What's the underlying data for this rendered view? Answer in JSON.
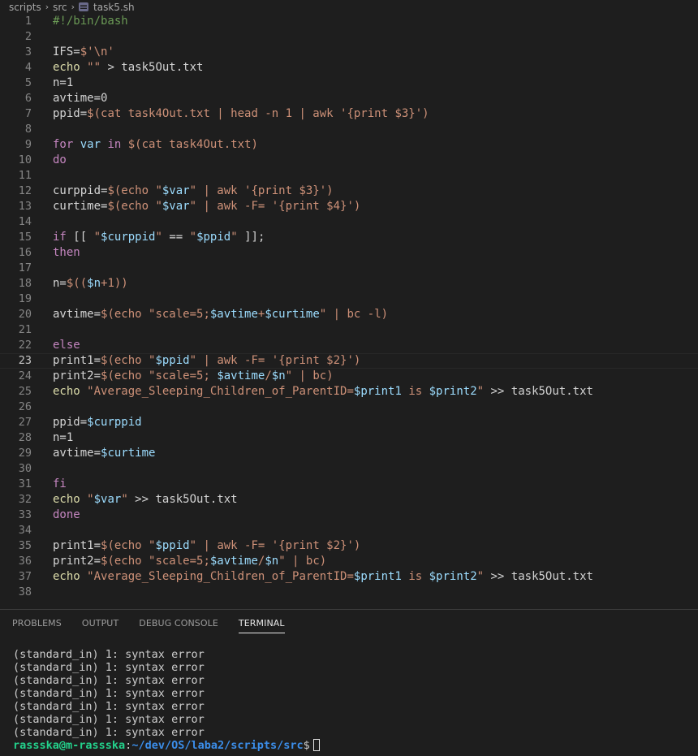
{
  "breadcrumb": {
    "items": [
      "scripts",
      "src"
    ],
    "file": "task5.sh"
  },
  "editor": {
    "current_line": 23,
    "lines": [
      [
        {
          "t": "#!/bin/bash",
          "c": "#6a9955"
        }
      ],
      [],
      [
        {
          "t": "IFS=",
          "c": "#d4d4d4"
        },
        {
          "t": "$'\\n'",
          "c": "#ce9178"
        }
      ],
      [
        {
          "t": "echo ",
          "c": "#dcdcaa"
        },
        {
          "t": "\"\"",
          "c": "#ce9178"
        },
        {
          "t": " > task5Out.txt",
          "c": "#d4d4d4"
        }
      ],
      [
        {
          "t": "n=1",
          "c": "#d4d4d4"
        }
      ],
      [
        {
          "t": "avtime=0",
          "c": "#d4d4d4"
        }
      ],
      [
        {
          "t": "ppid=",
          "c": "#d4d4d4"
        },
        {
          "t": "$(cat task4Out.txt | head -n 1 | awk '{print $3}')",
          "c": "#ce9178"
        }
      ],
      [],
      [
        {
          "t": "for ",
          "c": "#c586c0"
        },
        {
          "t": "var ",
          "c": "#9cdcfe"
        },
        {
          "t": "in ",
          "c": "#c586c0"
        },
        {
          "t": "$(cat task4Out.txt)",
          "c": "#ce9178"
        }
      ],
      [
        {
          "t": "do",
          "c": "#c586c0"
        }
      ],
      [],
      [
        {
          "t": "curppid=",
          "c": "#d4d4d4"
        },
        {
          "t": "$(echo \"",
          "c": "#ce9178"
        },
        {
          "t": "$var",
          "c": "#9cdcfe"
        },
        {
          "t": "\" | awk '{print $3}')",
          "c": "#ce9178"
        }
      ],
      [
        {
          "t": "curtime=",
          "c": "#d4d4d4"
        },
        {
          "t": "$(echo \"",
          "c": "#ce9178"
        },
        {
          "t": "$var",
          "c": "#9cdcfe"
        },
        {
          "t": "\" | awk -F= '{print $4}')",
          "c": "#ce9178"
        }
      ],
      [],
      [
        {
          "t": "if ",
          "c": "#c586c0"
        },
        {
          "t": "[[ ",
          "c": "#d4d4d4"
        },
        {
          "t": "\"",
          "c": "#ce9178"
        },
        {
          "t": "$curppid",
          "c": "#9cdcfe"
        },
        {
          "t": "\"",
          "c": "#ce9178"
        },
        {
          "t": " == ",
          "c": "#d4d4d4"
        },
        {
          "t": "\"",
          "c": "#ce9178"
        },
        {
          "t": "$ppid",
          "c": "#9cdcfe"
        },
        {
          "t": "\"",
          "c": "#ce9178"
        },
        {
          "t": " ]];",
          "c": "#d4d4d4"
        }
      ],
      [
        {
          "t": "then",
          "c": "#c586c0"
        }
      ],
      [],
      [
        {
          "t": "n=",
          "c": "#d4d4d4"
        },
        {
          "t": "$((",
          "c": "#ce9178"
        },
        {
          "t": "$n",
          "c": "#9cdcfe"
        },
        {
          "t": "+1))",
          "c": "#ce9178"
        }
      ],
      [],
      [
        {
          "t": "avtime=",
          "c": "#d4d4d4"
        },
        {
          "t": "$(echo \"scale=5;",
          "c": "#ce9178"
        },
        {
          "t": "$avtime",
          "c": "#9cdcfe"
        },
        {
          "t": "+",
          "c": "#ce9178"
        },
        {
          "t": "$curtime",
          "c": "#9cdcfe"
        },
        {
          "t": "\" | bc -l)",
          "c": "#ce9178"
        }
      ],
      [],
      [
        {
          "t": "else",
          "c": "#c586c0"
        }
      ],
      [
        {
          "t": "print1=",
          "c": "#d4d4d4"
        },
        {
          "t": "$(echo \"",
          "c": "#ce9178"
        },
        {
          "t": "$ppid",
          "c": "#9cdcfe"
        },
        {
          "t": "\" | awk -F= '{print $2}')",
          "c": "#ce9178"
        }
      ],
      [
        {
          "t": "print2=",
          "c": "#d4d4d4"
        },
        {
          "t": "$(echo \"scale=5; ",
          "c": "#ce9178"
        },
        {
          "t": "$avtime",
          "c": "#9cdcfe"
        },
        {
          "t": "/",
          "c": "#ce9178"
        },
        {
          "t": "$n",
          "c": "#9cdcfe"
        },
        {
          "t": "\" | bc)",
          "c": "#ce9178"
        }
      ],
      [
        {
          "t": "echo ",
          "c": "#dcdcaa"
        },
        {
          "t": "\"Average_Sleeping_Children_of_ParentID=",
          "c": "#ce9178"
        },
        {
          "t": "$print1",
          "c": "#9cdcfe"
        },
        {
          "t": " is ",
          "c": "#ce9178"
        },
        {
          "t": "$print2",
          "c": "#9cdcfe"
        },
        {
          "t": "\"",
          "c": "#ce9178"
        },
        {
          "t": " >> task5Out.txt",
          "c": "#d4d4d4"
        }
      ],
      [],
      [
        {
          "t": "ppid=",
          "c": "#d4d4d4"
        },
        {
          "t": "$curppid",
          "c": "#9cdcfe"
        }
      ],
      [
        {
          "t": "n=1",
          "c": "#d4d4d4"
        }
      ],
      [
        {
          "t": "avtime=",
          "c": "#d4d4d4"
        },
        {
          "t": "$curtime",
          "c": "#9cdcfe"
        }
      ],
      [],
      [
        {
          "t": "fi",
          "c": "#c586c0"
        }
      ],
      [
        {
          "t": "echo ",
          "c": "#dcdcaa"
        },
        {
          "t": "\"",
          "c": "#ce9178"
        },
        {
          "t": "$var",
          "c": "#9cdcfe"
        },
        {
          "t": "\"",
          "c": "#ce9178"
        },
        {
          "t": " >> task5Out.txt",
          "c": "#d4d4d4"
        }
      ],
      [
        {
          "t": "done",
          "c": "#c586c0"
        }
      ],
      [],
      [
        {
          "t": "print1=",
          "c": "#d4d4d4"
        },
        {
          "t": "$(echo \"",
          "c": "#ce9178"
        },
        {
          "t": "$ppid",
          "c": "#9cdcfe"
        },
        {
          "t": "\" | awk -F= '{print $2}')",
          "c": "#ce9178"
        }
      ],
      [
        {
          "t": "print2=",
          "c": "#d4d4d4"
        },
        {
          "t": "$(echo \"scale=5;",
          "c": "#ce9178"
        },
        {
          "t": "$avtime",
          "c": "#9cdcfe"
        },
        {
          "t": "/",
          "c": "#ce9178"
        },
        {
          "t": "$n",
          "c": "#9cdcfe"
        },
        {
          "t": "\" | bc)",
          "c": "#ce9178"
        }
      ],
      [
        {
          "t": "echo ",
          "c": "#dcdcaa"
        },
        {
          "t": "\"Average_Sleeping_Children_of_ParentID=",
          "c": "#ce9178"
        },
        {
          "t": "$print1",
          "c": "#9cdcfe"
        },
        {
          "t": " is ",
          "c": "#ce9178"
        },
        {
          "t": "$print2",
          "c": "#9cdcfe"
        },
        {
          "t": "\"",
          "c": "#ce9178"
        },
        {
          "t": " >> task5Out.txt",
          "c": "#d4d4d4"
        }
      ],
      []
    ]
  },
  "panel": {
    "tabs": [
      {
        "label": "PROBLEMS",
        "active": false
      },
      {
        "label": "OUTPUT",
        "active": false
      },
      {
        "label": "DEBUG CONSOLE",
        "active": false
      },
      {
        "label": "TERMINAL",
        "active": true
      }
    ]
  },
  "terminal": {
    "lines": [
      "(standard_in) 1: syntax error",
      "(standard_in) 1: syntax error",
      "(standard_in) 1: syntax error",
      "(standard_in) 1: syntax error",
      "(standard_in) 1: syntax error",
      "(standard_in) 1: syntax error",
      "(standard_in) 1: syntax error"
    ],
    "prompt_user": "rassska@m-rassska",
    "prompt_sep": ":",
    "prompt_path": "~/dev/OS/laba2/scripts/src",
    "prompt_symbol": "$"
  }
}
